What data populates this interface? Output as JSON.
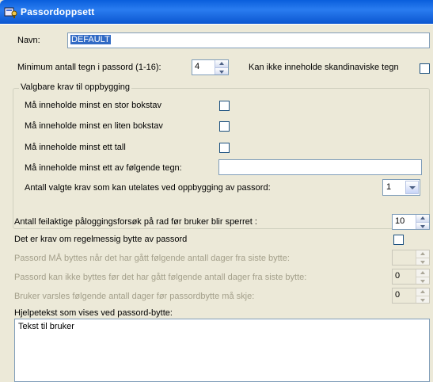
{
  "window": {
    "title": "Passordoppsett",
    "icon": "security-key-icon"
  },
  "name": {
    "label": "Navn:",
    "value": "DEFAULT"
  },
  "min_length": {
    "label": "Minimum antall tegn i passord (1-16):",
    "value": "4"
  },
  "no_scandinavian": {
    "label": "Kan ikke inneholde skandinaviske tegn",
    "checked": false
  },
  "requirements_group": {
    "title": "Valgbare krav til oppbygging",
    "uppercase": {
      "label": "Må inneholde minst en stor bokstav",
      "checked": false
    },
    "lowercase": {
      "label": "Må inneholde minst en liten bokstav",
      "checked": false
    },
    "digit": {
      "label": "Må inneholde minst ett tall",
      "checked": false
    },
    "special": {
      "label": "Må inneholde minst ett av følgende tegn:",
      "value": ""
    },
    "skippable": {
      "label": "Antall valgte krav som kan utelates ved oppbygging av passord:",
      "value": "1"
    }
  },
  "lockout": {
    "label": "Antall feilaktige påloggingsforsøk på rad før bruker blir sperret :",
    "value": "10"
  },
  "regular_change": {
    "label": "Det er krav om regelmessig bytte av passord",
    "checked": false
  },
  "must_change_days": {
    "label": "Passord MÅ byttes når det har gått følgende antall dager fra siste bytte:",
    "value": ""
  },
  "cannot_change_days": {
    "label": "Passord kan ikke byttes før det har gått følgende antall dager fra siste bytte:",
    "value": "0"
  },
  "warn_days": {
    "label": "Bruker varsles følgende antall dager før passordbytte må skje:",
    "value": "0"
  },
  "help_text": {
    "label": "Hjelpetekst som vises ved passord-bytte:",
    "value": "Tekst til bruker"
  },
  "colors": {
    "titlebar": "#0a5fdc",
    "background": "#ece9d8",
    "selection": "#316ac5"
  }
}
